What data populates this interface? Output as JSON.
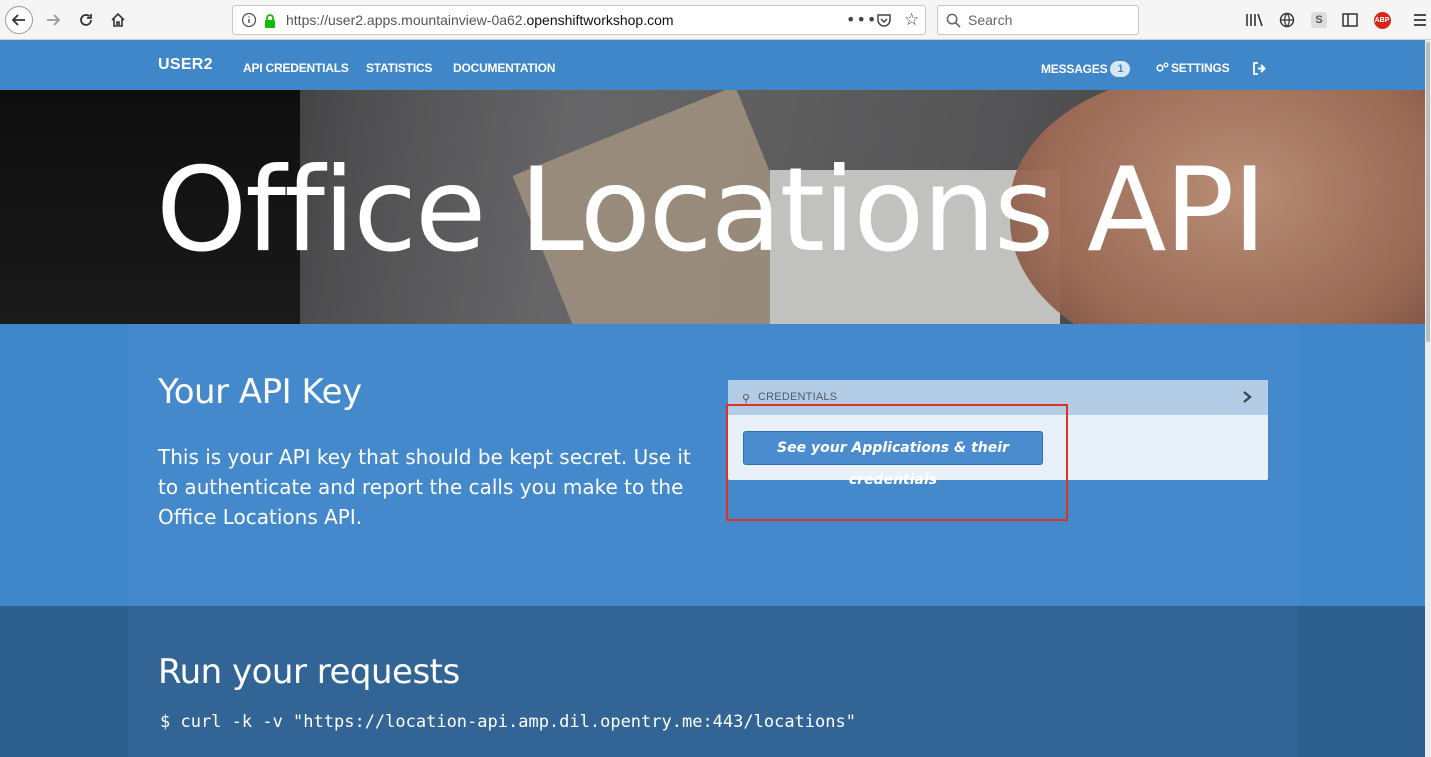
{
  "browser": {
    "url_prefix": "https://user2.apps.mountainview-0a62.",
    "url_domain": "openshiftworkshop.com",
    "search_placeholder": "Search",
    "icons": [
      "back-icon",
      "forward-icon",
      "reload-icon",
      "home-icon",
      "info-icon",
      "lock-icon",
      "page-actions-icon",
      "pocket-icon",
      "bookmark-star-icon",
      "search-icon",
      "library-icon",
      "globe-icon",
      "sync-icon",
      "sidebar-icon",
      "adblock-icon",
      "menu-icon"
    ],
    "adblock_label": "ABP",
    "sync_label": "S"
  },
  "nav": {
    "brand": "USER2",
    "links": [
      "API CREDENTIALS",
      "STATISTICS",
      "DOCUMENTATION"
    ],
    "messages_label": "MESSAGES",
    "messages_count": "1",
    "settings_label": "SETTINGS"
  },
  "hero": {
    "title": "Office Locations API"
  },
  "api_key": {
    "heading": "Your API Key",
    "description": "This is your API key that should be kept secret. Use it to authenticate and report the calls you make to the Office Locations API."
  },
  "credentials": {
    "header": "CREDENTIALS",
    "button_label": "See your Applications & their credentials"
  },
  "run": {
    "heading": "Run your requests",
    "command": "$ curl -k -v \"https://location-api.amp.dil.opentry.me:443/locations\""
  },
  "colors": {
    "nav_blue": "#3f87c9",
    "dark_section": "#2d5f8e",
    "highlight_red": "#e3311f"
  }
}
